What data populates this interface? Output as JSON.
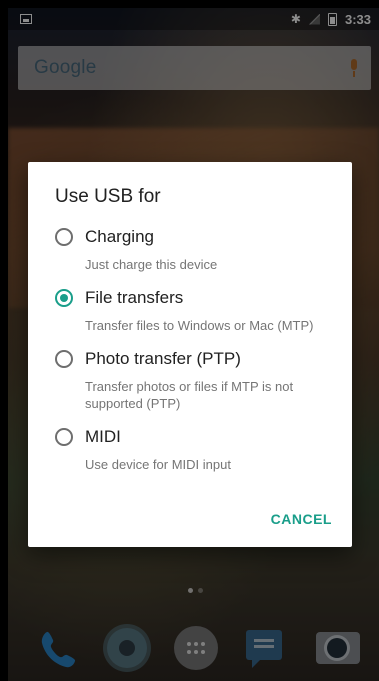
{
  "status_bar": {
    "time": "3:33",
    "icons": [
      "notification-icon",
      "bluetooth-icon",
      "no-sim-icon",
      "battery-icon"
    ]
  },
  "search_bar": {
    "logo": "Google",
    "mic_icon": "mic-icon"
  },
  "dialog": {
    "title": "Use USB for",
    "options": [
      {
        "label": "Charging",
        "description": "Just charge this device",
        "selected": false
      },
      {
        "label": "File transfers",
        "description": "Transfer files to Windows or Mac (MTP)",
        "selected": true
      },
      {
        "label": "Photo transfer (PTP)",
        "description": "Transfer photos or files if MTP is not supported (PTP)",
        "selected": false
      },
      {
        "label": "MIDI",
        "description": "Use device for MIDI input",
        "selected": false
      }
    ],
    "cancel_label": "CANCEL"
  },
  "dock": {
    "items": [
      "phone-icon",
      "settings-icon",
      "all-apps-icon",
      "messages-icon",
      "camera-icon"
    ]
  },
  "colors": {
    "accent": "#1a9e8a"
  }
}
